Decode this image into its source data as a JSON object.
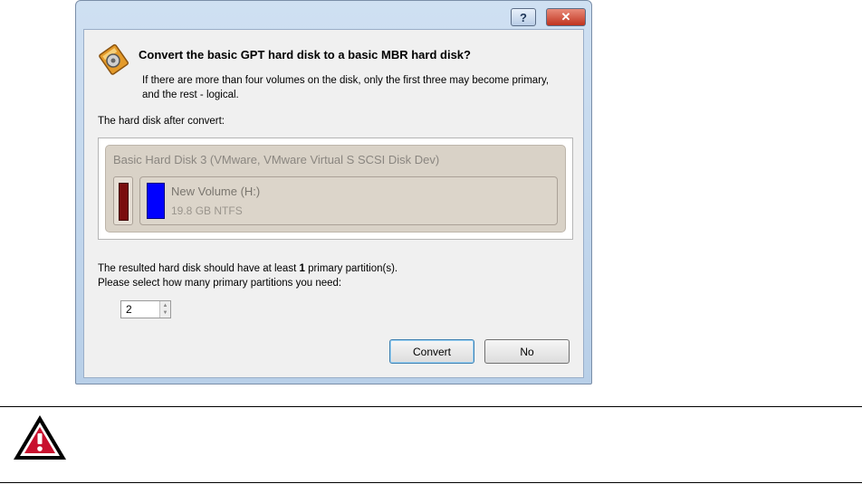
{
  "dialog": {
    "titlebar": {
      "help_label": "?",
      "close_label": "✕"
    },
    "heading": "Convert the basic GPT hard disk to a basic MBR hard disk?",
    "description": "If there are more than four volumes on the disk, only the first three may become primary, and the rest - logical.",
    "after_label": "The hard disk after convert:",
    "disk": {
      "title": "Basic Hard Disk 3 (VMware, VMware Virtual S SCSI Disk Dev)",
      "volume": {
        "name": "New Volume (H:)",
        "size": "19.8 GB NTFS",
        "color": "#0000ff"
      },
      "system_bar_color": "#7a0d0d"
    },
    "note_prefix": "The resulted hard disk should have at least ",
    "note_count": "1",
    "note_suffix": " primary partition(s).",
    "select_prompt": "Please select how many primary partitions you need:",
    "spinner_value": "2",
    "buttons": {
      "convert": "Convert",
      "no": "No"
    }
  },
  "warning": {
    "icon": "warning-triangle-icon"
  }
}
